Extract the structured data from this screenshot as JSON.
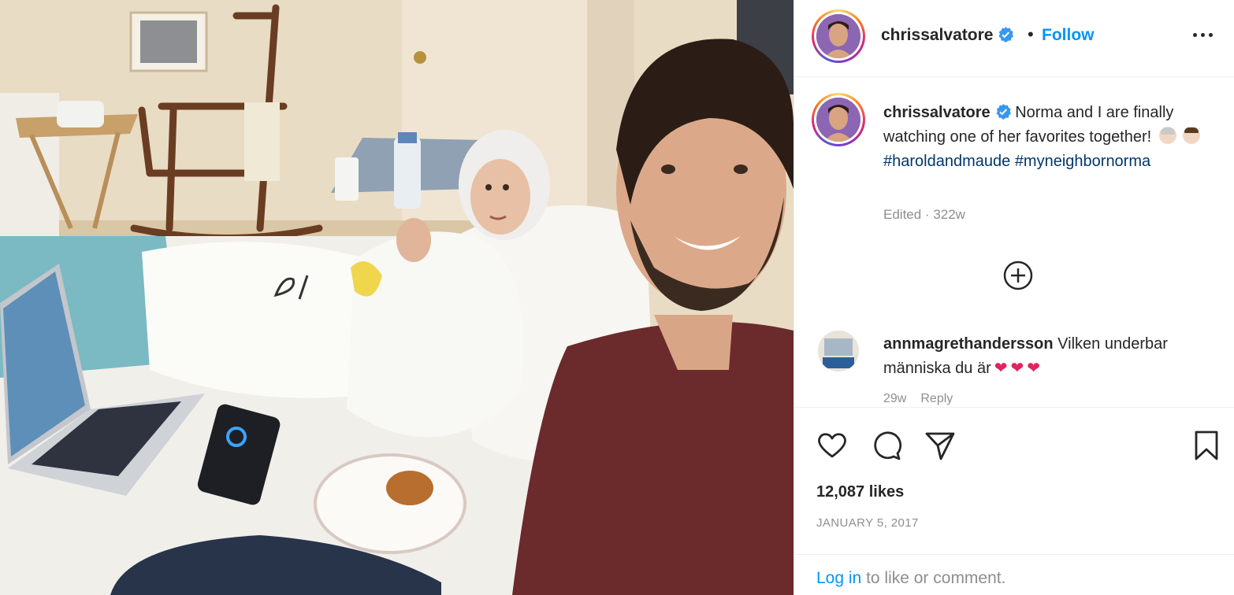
{
  "post": {
    "username": "chrissalvatore",
    "separator": "•",
    "follow_label": "Follow",
    "more_icon": "more-horizontal-icon"
  },
  "caption": {
    "username": "chrissalvatore",
    "text": "Norma and I are finally watching one of her favorites together!",
    "emojis": [
      "old-woman-emoji",
      "boy-emoji"
    ],
    "hashtags": [
      "#haroldandmaude",
      "#myneighbornorma"
    ],
    "edited": "Edited",
    "age": "322w"
  },
  "comment": {
    "username": "annmagrethandersson",
    "text": "Vilken underbar människa du är",
    "hearts": [
      "❤",
      "❤",
      "❤"
    ],
    "age": "29w",
    "reply_label": "Reply"
  },
  "actions": {
    "icons": [
      "heart-icon",
      "comment-icon",
      "share-icon",
      "bookmark-icon"
    ]
  },
  "likes": "12,087 likes",
  "date": "JANUARY 5, 2017",
  "login": {
    "link": "Log in",
    "rest": "to like or comment."
  },
  "colors": {
    "accent": "#0095f6",
    "hashtag": "#00376b",
    "muted": "#8e8e8e",
    "heart": "#e0245e",
    "text": "#262626"
  }
}
